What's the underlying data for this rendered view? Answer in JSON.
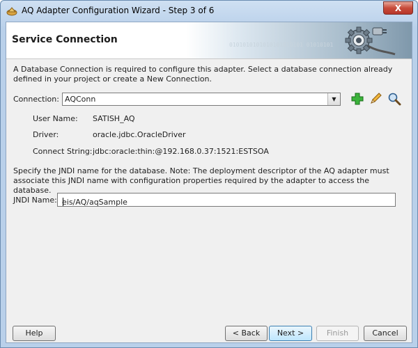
{
  "window": {
    "title": "AQ Adapter Configuration Wizard - Step 3 of 6",
    "close_label": "X"
  },
  "header": {
    "title": "Service Connection",
    "decoration_text": "0101010101010101010101 01010101"
  },
  "description": "A Database Connection is required to configure this adapter. Select a database connection already defined in your project or create a New Connection.",
  "connection": {
    "label": "Connection:",
    "selected": "AQConn",
    "icons": [
      "add-icon",
      "edit-icon",
      "browse-icon"
    ]
  },
  "details": {
    "user_label": "User Name:",
    "user_value": "SATISH_AQ",
    "driver_label": "Driver:",
    "driver_value": "oracle.jdbc.OracleDriver",
    "connect_label": "Connect String:",
    "connect_value": "jdbc:oracle:thin:@192.168.0.37:1521:ESTSOA"
  },
  "jndi": {
    "note": "Specify the JNDI name for the database.  Note: The deployment descriptor of the AQ adapter must associate this JNDI name with configuration properties required by the adapter to access the database.",
    "label": "JNDI Name:",
    "value": "eis/AQ/aqSample"
  },
  "buttons": {
    "help": "Help",
    "back": "< Back",
    "next": "Next >",
    "finish": "Finish",
    "cancel": "Cancel"
  }
}
